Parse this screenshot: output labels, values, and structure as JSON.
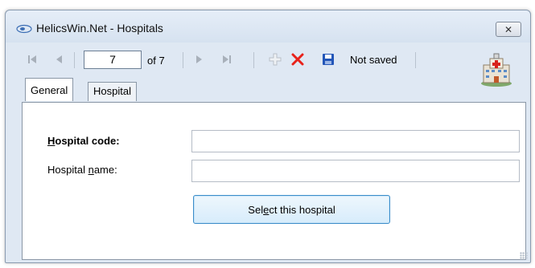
{
  "window": {
    "title": "HelicsWin.Net - Hospitals",
    "close_label": "✕"
  },
  "toolbar": {
    "first_icon": "first-record-icon",
    "prev_icon": "previous-record-icon",
    "record_number": "7",
    "record_of": "of 7",
    "next_icon": "next-record-icon",
    "last_icon": "last-record-icon",
    "add_icon": "add-record-icon",
    "delete_icon": "delete-record-icon",
    "save_icon": "save-icon",
    "status": "Not saved"
  },
  "tabs": [
    {
      "label": "General",
      "active": true
    },
    {
      "label": "Hospital list",
      "active": false
    }
  ],
  "form": {
    "hospital_code_label_pre": "",
    "hospital_code_label_accel": "H",
    "hospital_code_label_post": "ospital code:",
    "hospital_code_value": "",
    "hospital_name_label_pre": "Hospital ",
    "hospital_name_label_accel": "n",
    "hospital_name_label_post": "ame:",
    "hospital_name_value": "",
    "select_pre": "Sel",
    "select_accel": "e",
    "select_post": "ct this hospital"
  },
  "colors": {
    "delete": "#e8221a",
    "save": "#2356b8",
    "add": "#b9c0c8",
    "button_border": "#3c8dc9"
  }
}
